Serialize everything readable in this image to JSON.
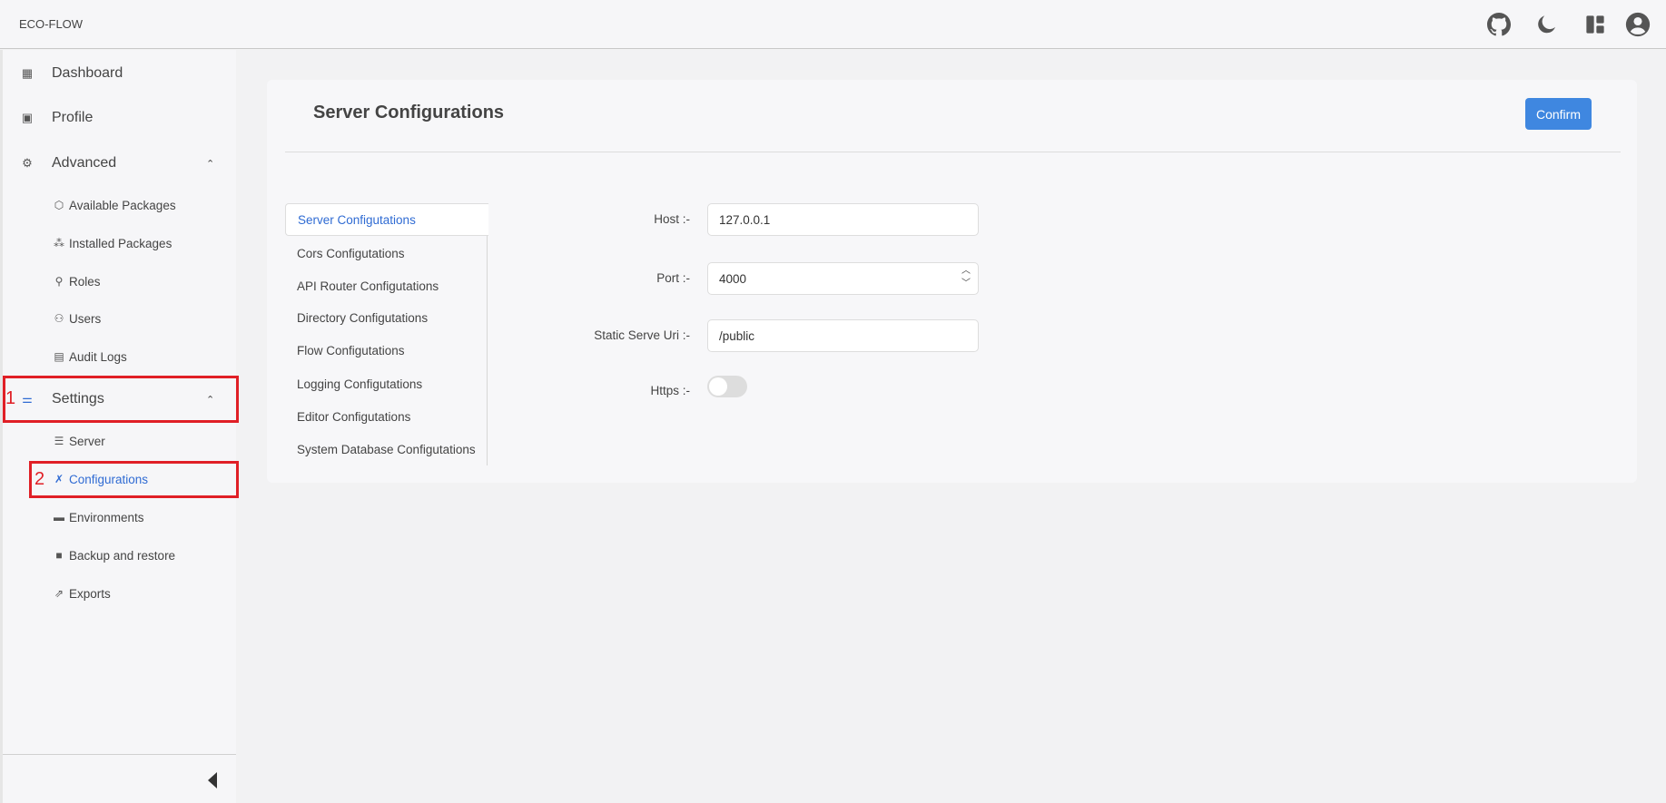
{
  "header": {
    "brand": "ECO-FLOW",
    "icons": [
      "github-icon",
      "moon-icon",
      "layout-icon",
      "user-account-icon"
    ]
  },
  "sidebar": {
    "items": [
      {
        "label": "Dashboard",
        "icon": "dashboard-icon"
      },
      {
        "label": "Profile",
        "icon": "profile-icon"
      },
      {
        "label": "Advanced",
        "icon": "advanced-icon",
        "expanded": true,
        "children": [
          {
            "label": "Available Packages",
            "icon": "package-icon"
          },
          {
            "label": "Installed Packages",
            "icon": "packages-icon"
          },
          {
            "label": "Roles",
            "icon": "roles-icon"
          },
          {
            "label": "Users",
            "icon": "users-icon"
          },
          {
            "label": "Audit Logs",
            "icon": "audit-icon"
          }
        ]
      },
      {
        "label": "Settings",
        "icon": "sliders-icon",
        "expanded": true,
        "children": [
          {
            "label": "Server",
            "icon": "server-icon"
          },
          {
            "label": "Configurations",
            "icon": "tools-icon",
            "active": true
          },
          {
            "label": "Environments",
            "icon": "env-icon"
          },
          {
            "label": "Backup and restore",
            "icon": "backup-icon"
          },
          {
            "label": "Exports",
            "icon": "export-icon"
          }
        ]
      }
    ],
    "annotations": [
      "1",
      "2"
    ]
  },
  "main": {
    "title": "Server Configurations",
    "confirm_label": "Confirm",
    "tabs": [
      "Server Configutations",
      "Cors Configutations",
      "API Router Configutations",
      "Directory Configutations",
      "Flow Configutations",
      "Logging Configutations",
      "Editor Configutations",
      "System Database Configutations"
    ],
    "selected_tab": 0,
    "form": {
      "host": {
        "label": "Host :-",
        "value": "127.0.0.1"
      },
      "port": {
        "label": "Port :-",
        "value": "4000"
      },
      "static": {
        "label": "Static Serve Uri :-",
        "value": "/public"
      },
      "https": {
        "label": "Https :-",
        "value": false
      }
    }
  },
  "colors": {
    "accent": "#3f87e0",
    "active_link": "#2f6bd3",
    "annotation": "#e01f26"
  }
}
